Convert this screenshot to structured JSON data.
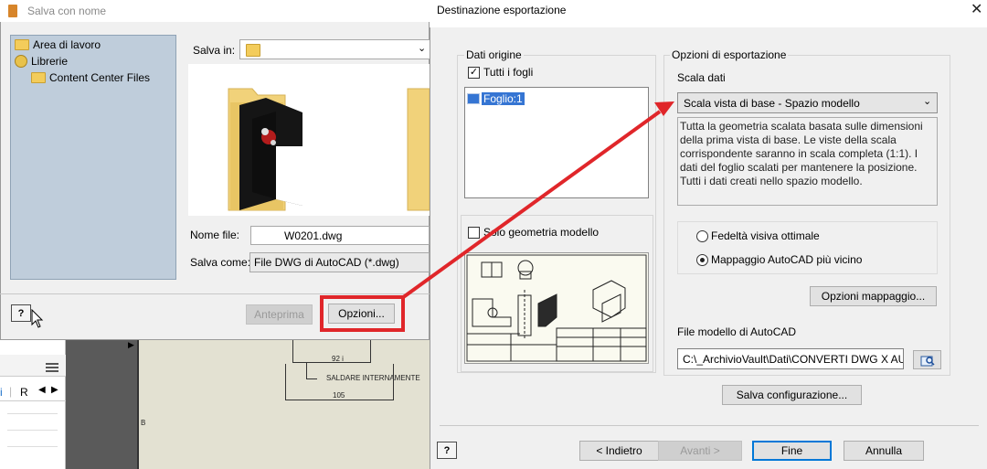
{
  "save_dialog": {
    "title": "Salva con nome",
    "places": [
      "Area di lavoro",
      "Librerie",
      "Content Center Files"
    ],
    "save_in_label": "Salva in:",
    "filename_label": "Nome file:",
    "filename_value": "W0201.dwg",
    "saveas_label": "Salva come:",
    "saveas_value": "File DWG di AutoCAD (*.dwg)",
    "help": "?",
    "preview_button": "Anteprima",
    "options_button": "Opzioni..."
  },
  "background": {
    "dim_92": "92 i",
    "weld_note": "SALDARE INTERNAMENTE",
    "dim_105": "105",
    "tab_r": "R",
    "tab_i": "i",
    "b_label": "B"
  },
  "export_dialog": {
    "title": "Destinazione esportazione",
    "source_group": "Dati origine",
    "all_sheets_label": "Tutti i fogli",
    "sheet_item": "Foglio:1",
    "model_geometry_label": "Solo geometria modello",
    "options_group": "Opzioni di esportazione",
    "scale_label": "Scala dati",
    "scale_value": "Scala vista di base - Spazio modello",
    "scale_description": "Tutta la geometria scalata basata sulle dimensioni della prima vista di base. Le viste della scala corrispondente saranno in scala completa (1:1). I dati del foglio scalati per mantenere la posizione. Tutti i dati creati nello spazio modello.",
    "radio_visual": "Fedeltà visiva ottimale",
    "radio_mapping": "Mappaggio AutoCAD più vicino",
    "mapping_options_button": "Opzioni mappaggio...",
    "template_label": "File modello di AutoCAD",
    "template_value": "C:\\_ArchivioVault\\Dati\\CONVERTI DWG X AU",
    "save_config_button": "Salva configurazione...",
    "help": "?",
    "back_button": "< Indietro",
    "next_button": "Avanti >",
    "finish_button": "Fine",
    "cancel_button": "Annulla",
    "close": "✕"
  },
  "colors": {
    "highlight_red": "#e0262a",
    "selection_blue": "#3575d3",
    "places_bg": "#bfcddb"
  }
}
